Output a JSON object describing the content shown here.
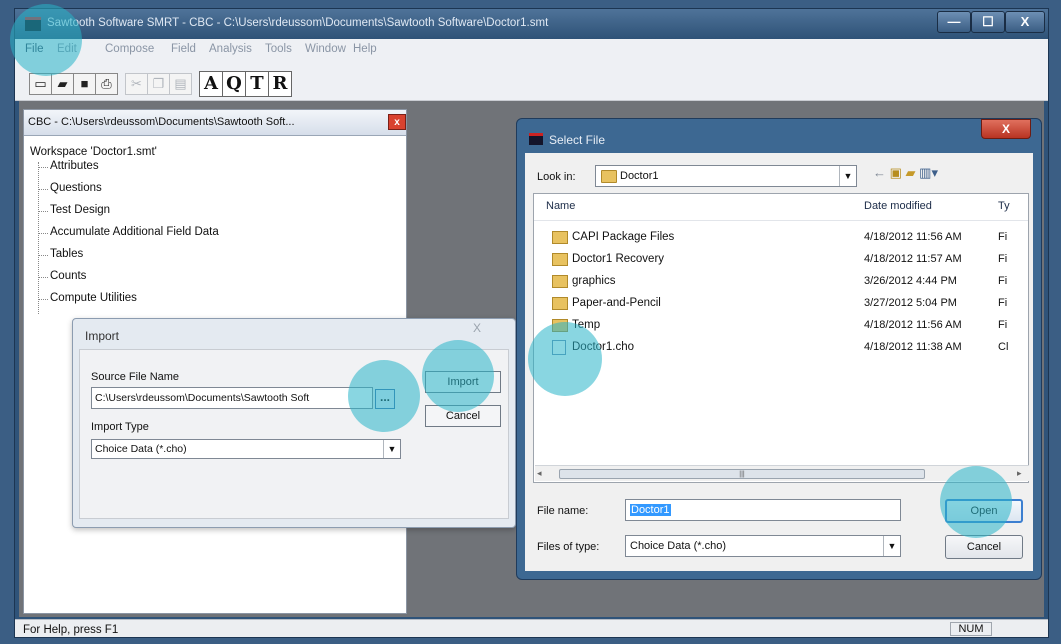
{
  "window": {
    "title": "Sawtooth Software SMRT - CBC - C:\\Users\\rdeussom\\Documents\\Sawtooth Software\\Doctor1.smt",
    "min_label": "—",
    "max_label": "☐",
    "close_label": "X"
  },
  "menu": [
    "File",
    "Edit",
    "Compose",
    "Field",
    "Analysis",
    "Tools",
    "Window",
    "Help"
  ],
  "toolbar_letters": [
    "A",
    "Q",
    "T",
    "R"
  ],
  "workspace": {
    "header": "CBC - C:\\Users\\rdeussom\\Documents\\Sawtooth Soft...",
    "close_label": "x",
    "root": "Workspace 'Doctor1.smt'",
    "items": [
      "Attributes",
      "Questions",
      "Test Design",
      "Accumulate Additional Field Data",
      "Tables",
      "Counts",
      "Compute Utilities"
    ]
  },
  "import_dialog": {
    "title": "Import",
    "close_label": "X",
    "source_label": "Source File Name",
    "source_value": "C:\\Users\\rdeussom\\Documents\\Sawtooth Soft",
    "browse_label": "...",
    "type_label": "Import Type",
    "type_value": "Choice Data (*.cho)",
    "import_button": "Import",
    "cancel_button": "Cancel"
  },
  "file_dialog": {
    "title": "Select File",
    "close_label": "X",
    "lookin_label": "Look in:",
    "lookin_value": "Doctor1",
    "columns": {
      "name": "Name",
      "date": "Date modified",
      "type": "Ty"
    },
    "rows": [
      {
        "name": "CAPI Package Files",
        "date": "4/18/2012 11:56 AM",
        "type": "Fi",
        "kind": "folder"
      },
      {
        "name": "Doctor1 Recovery",
        "date": "4/18/2012 11:57 AM",
        "type": "Fi",
        "kind": "folder"
      },
      {
        "name": "graphics",
        "date": "3/26/2012 4:44 PM",
        "type": "Fi",
        "kind": "folder"
      },
      {
        "name": "Paper-and-Pencil",
        "date": "3/27/2012 5:04 PM",
        "type": "Fi",
        "kind": "folder"
      },
      {
        "name": "Temp",
        "date": "4/18/2012 11:56 AM",
        "type": "Fi",
        "kind": "folder"
      },
      {
        "name": "Doctor1.cho",
        "date": "4/18/2012 11:38 AM",
        "type": "Cl",
        "kind": "file"
      }
    ],
    "filename_label": "File name:",
    "filename_value": "Doctor1",
    "filetype_label": "Files of type:",
    "filetype_value": "Choice Data (*.cho)",
    "open_button": "Open",
    "cancel_button": "Cancel"
  },
  "status": {
    "text": "For Help, press F1",
    "num": "NUM"
  }
}
